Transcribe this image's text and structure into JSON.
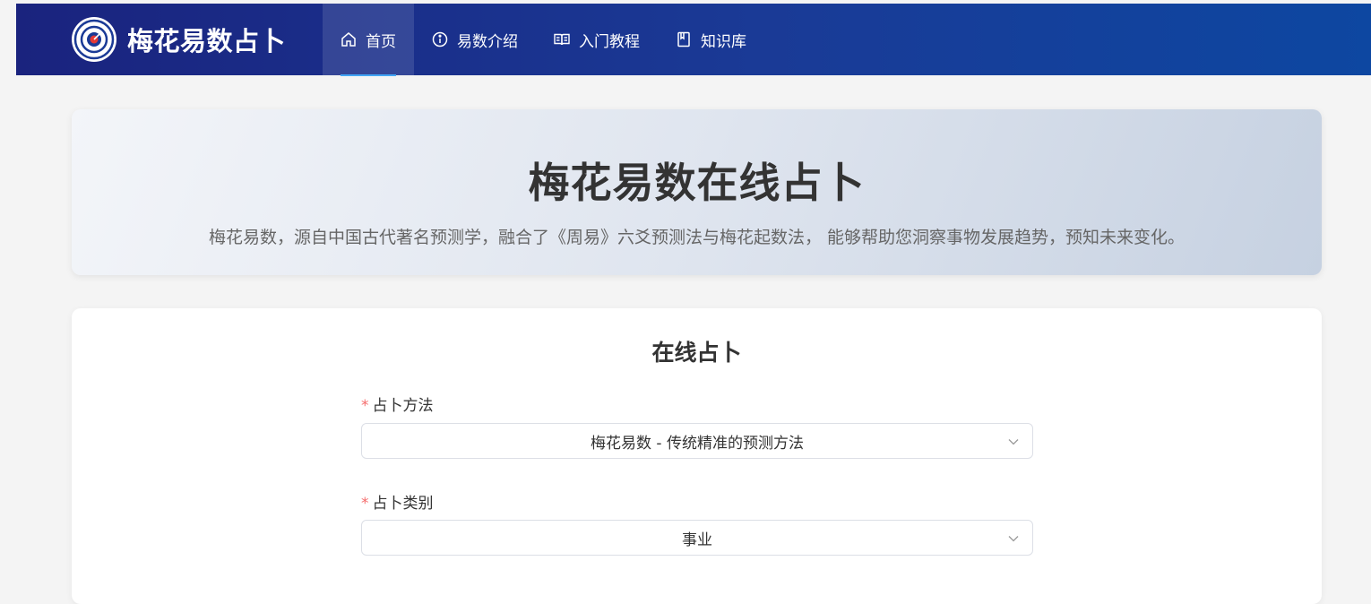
{
  "header": {
    "logo_icon": "compass-logo-icon",
    "title": "梅花易数占卜",
    "nav": [
      {
        "label": "首页",
        "icon": "home-icon",
        "active": true
      },
      {
        "label": "易数介绍",
        "icon": "info-icon",
        "active": false
      },
      {
        "label": "入门教程",
        "icon": "book-open-icon",
        "active": false
      },
      {
        "label": "知识库",
        "icon": "notebook-icon",
        "active": false
      }
    ]
  },
  "hero": {
    "title": "梅花易数在线占卜",
    "description": "梅花易数，源自中国古代著名预测学，融合了《周易》六爻预测法与梅花起数法， 能够帮助您洞察事物发展趋势，预知未来变化。"
  },
  "form": {
    "title": "在线占卜",
    "required_mark": "*",
    "method": {
      "label": "占卜方法",
      "value": "梅花易数 - 传统精准的预测方法"
    },
    "category": {
      "label": "占卜类别",
      "value": "事业"
    }
  },
  "colors": {
    "nav_gradient_start": "#1a237e",
    "nav_gradient_end": "#0d47a1",
    "required": "#f56c6c",
    "active_underline": "#42a5f5"
  }
}
